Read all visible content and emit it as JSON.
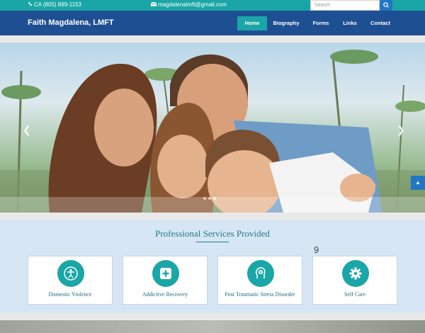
{
  "topbar": {
    "phone": "CA (805) 899-1153",
    "email": "magdalenalmft@gmail.com",
    "search_placeholder": "Search",
    "phone_icon": "phone-icon",
    "email_icon": "envelope-icon",
    "search_icon": "magnifier-icon"
  },
  "navbar": {
    "brand": "Faith Magdalena, LMFT",
    "items": [
      "Home",
      "Biography",
      "Forms",
      "Links",
      "Contact"
    ],
    "active": "Home"
  },
  "hero": {
    "prev_icon": "chevron-left-icon",
    "next_icon": "chevron-right-icon",
    "slide_count": 3
  },
  "services": {
    "title": "Professional Services Provided",
    "stray_text": "9",
    "cards": [
      {
        "label": "Domestic Violence",
        "icon": "person-circle-icon"
      },
      {
        "label": "Addictive Recovery",
        "icon": "plus-square-icon"
      },
      {
        "label": "Post Traumatic Stress Disorder",
        "icon": "brain-head-icon"
      },
      {
        "label": "Self Care",
        "icon": "gear-icon"
      }
    ]
  },
  "colors": {
    "teal": "#1aa6a6",
    "navy": "#1e4f93",
    "blue": "#2277c4",
    "services_bg": "#d7e6f4",
    "service_text": "#1d6b7e"
  }
}
